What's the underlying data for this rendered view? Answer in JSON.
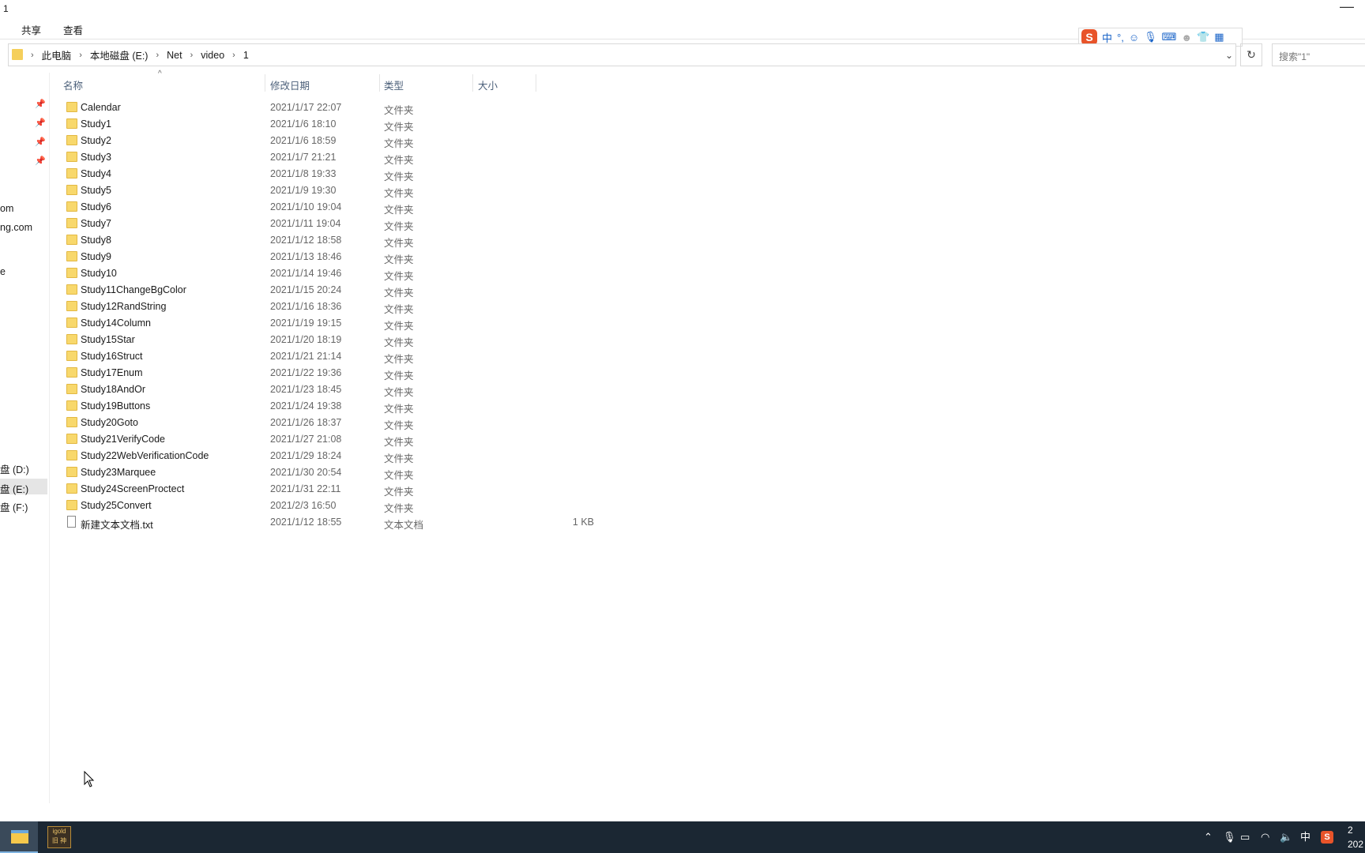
{
  "window": {
    "title": "1",
    "minimize_glyph": "—"
  },
  "ribbon": {
    "tabs": [
      "共享",
      "查看"
    ]
  },
  "address": {
    "crumbs": [
      "此电脑",
      "本地磁盘 (E:)",
      "Net",
      "video",
      "1"
    ],
    "search_placeholder": "搜索\"1\""
  },
  "ime": {
    "logo": "S",
    "mode": "中",
    "punct": "°,"
  },
  "nav": {
    "items": [
      "om",
      "ng.com",
      "e",
      "盘 (D:)",
      "盘 (E:)",
      "盘 (F:)"
    ],
    "selected": "盘 (E:)"
  },
  "columns": {
    "name": "名称",
    "modified": "修改日期",
    "type": "类型",
    "size": "大小"
  },
  "files": [
    {
      "name": "Calendar",
      "modified": "2021/1/17 22:07",
      "type": "文件夹",
      "size": "",
      "kind": "folder"
    },
    {
      "name": "Study1",
      "modified": "2021/1/6 18:10",
      "type": "文件夹",
      "size": "",
      "kind": "folder"
    },
    {
      "name": "Study2",
      "modified": "2021/1/6 18:59",
      "type": "文件夹",
      "size": "",
      "kind": "folder"
    },
    {
      "name": "Study3",
      "modified": "2021/1/7 21:21",
      "type": "文件夹",
      "size": "",
      "kind": "folder"
    },
    {
      "name": "Study4",
      "modified": "2021/1/8 19:33",
      "type": "文件夹",
      "size": "",
      "kind": "folder"
    },
    {
      "name": "Study5",
      "modified": "2021/1/9 19:30",
      "type": "文件夹",
      "size": "",
      "kind": "folder"
    },
    {
      "name": "Study6",
      "modified": "2021/1/10 19:04",
      "type": "文件夹",
      "size": "",
      "kind": "folder"
    },
    {
      "name": "Study7",
      "modified": "2021/1/11 19:04",
      "type": "文件夹",
      "size": "",
      "kind": "folder"
    },
    {
      "name": "Study8",
      "modified": "2021/1/12 18:58",
      "type": "文件夹",
      "size": "",
      "kind": "folder"
    },
    {
      "name": "Study9",
      "modified": "2021/1/13 18:46",
      "type": "文件夹",
      "size": "",
      "kind": "folder"
    },
    {
      "name": "Study10",
      "modified": "2021/1/14 19:46",
      "type": "文件夹",
      "size": "",
      "kind": "folder"
    },
    {
      "name": "Study11ChangeBgColor",
      "modified": "2021/1/15 20:24",
      "type": "文件夹",
      "size": "",
      "kind": "folder"
    },
    {
      "name": "Study12RandString",
      "modified": "2021/1/16 18:36",
      "type": "文件夹",
      "size": "",
      "kind": "folder"
    },
    {
      "name": "Study14Column",
      "modified": "2021/1/19 19:15",
      "type": "文件夹",
      "size": "",
      "kind": "folder"
    },
    {
      "name": "Study15Star",
      "modified": "2021/1/20 18:19",
      "type": "文件夹",
      "size": "",
      "kind": "folder"
    },
    {
      "name": "Study16Struct",
      "modified": "2021/1/21 21:14",
      "type": "文件夹",
      "size": "",
      "kind": "folder"
    },
    {
      "name": "Study17Enum",
      "modified": "2021/1/22 19:36",
      "type": "文件夹",
      "size": "",
      "kind": "folder"
    },
    {
      "name": "Study18AndOr",
      "modified": "2021/1/23 18:45",
      "type": "文件夹",
      "size": "",
      "kind": "folder"
    },
    {
      "name": "Study19Buttons",
      "modified": "2021/1/24 19:38",
      "type": "文件夹",
      "size": "",
      "kind": "folder"
    },
    {
      "name": "Study20Goto",
      "modified": "2021/1/26 18:37",
      "type": "文件夹",
      "size": "",
      "kind": "folder"
    },
    {
      "name": "Study21VerifyCode",
      "modified": "2021/1/27 21:08",
      "type": "文件夹",
      "size": "",
      "kind": "folder"
    },
    {
      "name": "Study22WebVerificationCode",
      "modified": "2021/1/29 18:24",
      "type": "文件夹",
      "size": "",
      "kind": "folder"
    },
    {
      "name": "Study23Marquee",
      "modified": "2021/1/30 20:54",
      "type": "文件夹",
      "size": "",
      "kind": "folder"
    },
    {
      "name": "Study24ScreenProctect",
      "modified": "2021/1/31 22:11",
      "type": "文件夹",
      "size": "",
      "kind": "folder"
    },
    {
      "name": "Study25Convert",
      "modified": "2021/2/3 16:50",
      "type": "文件夹",
      "size": "",
      "kind": "folder"
    },
    {
      "name": "新建文本文档.txt",
      "modified": "2021/1/12 18:55",
      "type": "文本文档",
      "size": "1 KB",
      "kind": "text"
    }
  ],
  "taskbar": {
    "app_label_top": "igold",
    "app_label_bottom": "旧 神",
    "ime_mode": "中",
    "clock_line1": "2",
    "clock_line2": "202"
  },
  "colors": {
    "folder": "#f8d86c",
    "taskbar": "#1b2733",
    "ime_brand": "#e8542a"
  }
}
